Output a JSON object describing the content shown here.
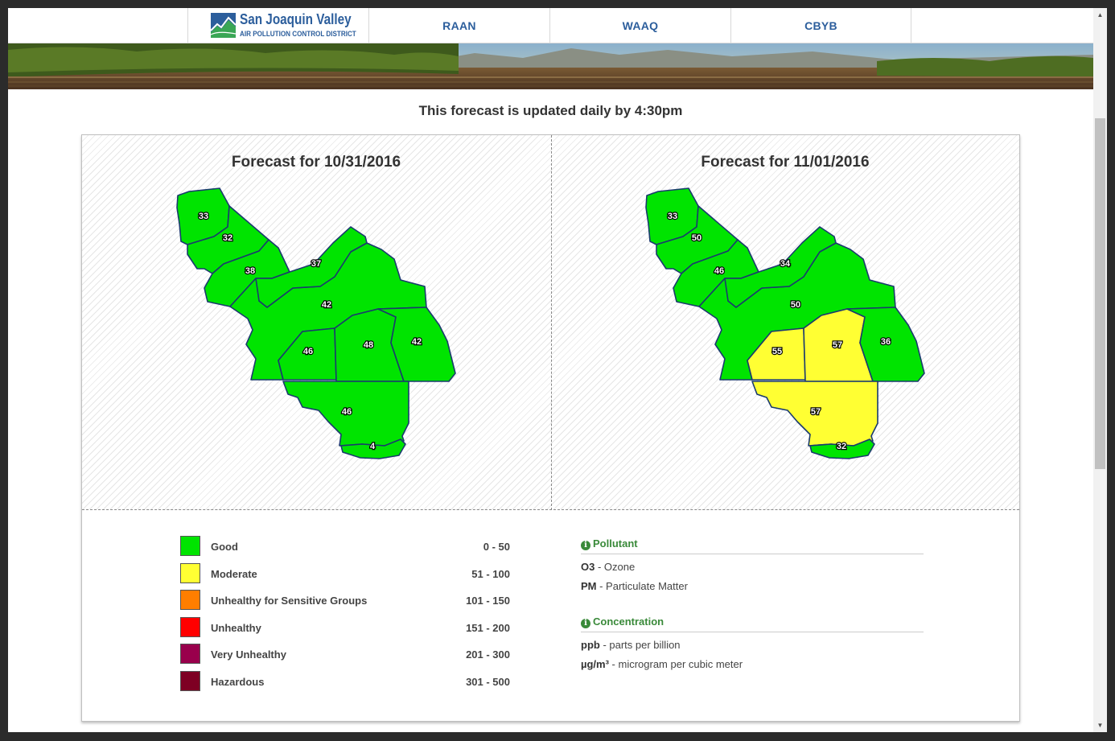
{
  "header": {
    "logo_title": "San Joaquin Valley",
    "logo_subtitle": "AIR POLLUTION CONTROL DISTRICT",
    "nav": [
      {
        "label": "RAAN"
      },
      {
        "label": "WAAQ"
      },
      {
        "label": "CBYB"
      }
    ]
  },
  "notice": "This forecast is updated daily by 4:30pm",
  "forecasts": [
    {
      "title": "Forecast for 10/31/2016",
      "regions": {
        "san_joaquin": {
          "value": "33",
          "category": "good"
        },
        "stanislaus": {
          "value": "32",
          "category": "good"
        },
        "merced": {
          "value": "38",
          "category": "good"
        },
        "madera": {
          "value": "37",
          "category": "good"
        },
        "fresno": {
          "value": "42",
          "category": "good"
        },
        "kings": {
          "value": "46",
          "category": "good"
        },
        "tulare_west": {
          "value": "48",
          "category": "good"
        },
        "tulare_east": {
          "value": "42",
          "category": "good"
        },
        "kern": {
          "value": "46",
          "category": "good"
        },
        "kern_south": {
          "value": "4",
          "category": "good"
        }
      }
    },
    {
      "title": "Forecast for 11/01/2016",
      "regions": {
        "san_joaquin": {
          "value": "33",
          "category": "good"
        },
        "stanislaus": {
          "value": "50",
          "category": "good"
        },
        "merced": {
          "value": "46",
          "category": "good"
        },
        "madera": {
          "value": "34",
          "category": "good"
        },
        "fresno": {
          "value": "50",
          "category": "good"
        },
        "kings": {
          "value": "55",
          "category": "moderate"
        },
        "tulare_west": {
          "value": "57",
          "category": "moderate"
        },
        "tulare_east": {
          "value": "36",
          "category": "good"
        },
        "kern": {
          "value": "57",
          "category": "moderate"
        },
        "kern_south": {
          "value": "32",
          "category": "good"
        }
      }
    }
  ],
  "colors": {
    "good": "#00e400",
    "moderate": "#ffff33",
    "usg": "#ff7e00",
    "unhealthy": "#ff0000",
    "very_unhealthy": "#99004c",
    "hazardous": "#7e0023",
    "border": "#1a3a6e"
  },
  "legend": [
    {
      "label": "Good",
      "range": "0 - 50",
      "color": "#00e400"
    },
    {
      "label": "Moderate",
      "range": "51 - 100",
      "color": "#ffff33"
    },
    {
      "label": "Unhealthy for Sensitive Groups",
      "range": "101 - 150",
      "color": "#ff7e00"
    },
    {
      "label": "Unhealthy",
      "range": "151 - 200",
      "color": "#ff0000"
    },
    {
      "label": "Very Unhealthy",
      "range": "201 - 300",
      "color": "#99004c"
    },
    {
      "label": "Hazardous",
      "range": "301 - 500",
      "color": "#7e0023"
    }
  ],
  "info": {
    "pollutant": {
      "heading": "Pollutant",
      "rows": [
        {
          "abbr": "O3",
          "desc": " - Ozone"
        },
        {
          "abbr": "PM",
          "desc": " - Particulate Matter"
        }
      ]
    },
    "concentration": {
      "heading": "Concentration",
      "rows": [
        {
          "abbr": "ppb",
          "desc": " - parts per billion"
        },
        {
          "abbr": "µg/m³",
          "desc": " - microgram per cubic meter"
        }
      ]
    }
  }
}
